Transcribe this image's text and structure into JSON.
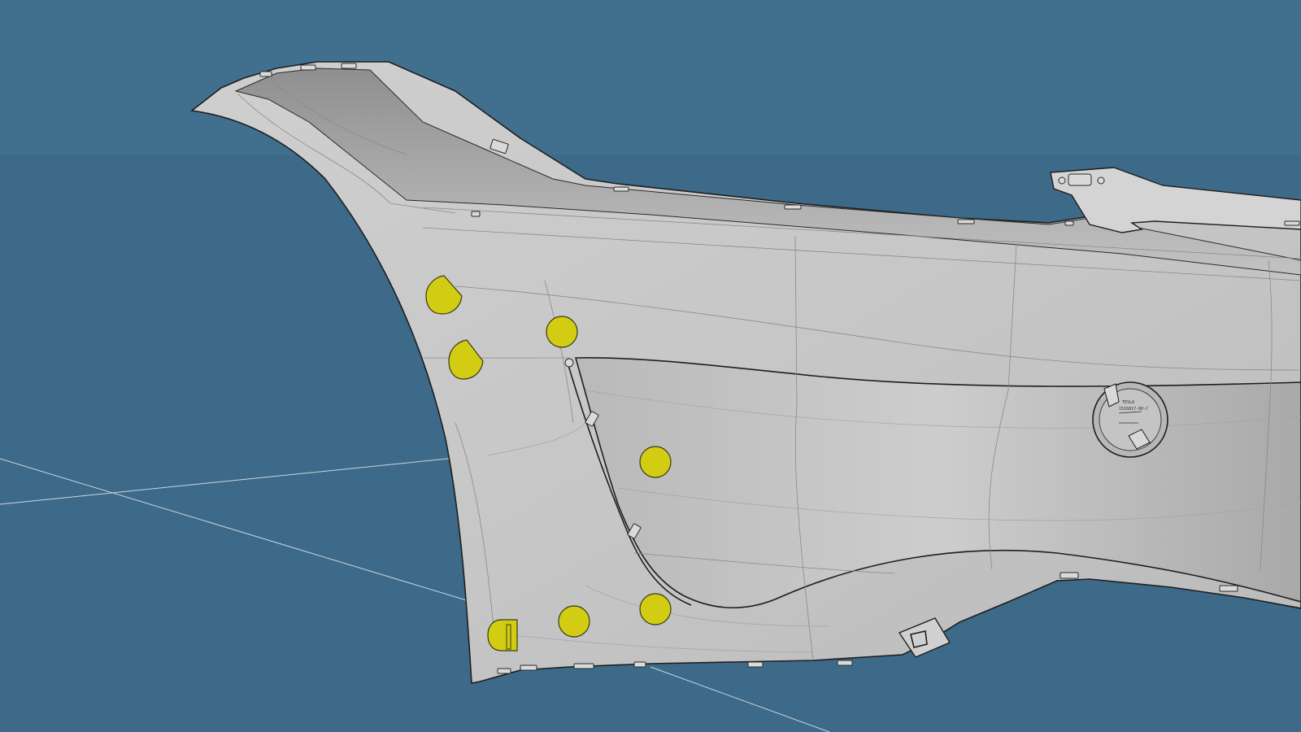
{
  "viewport": {
    "name": "3d-cad-viewport",
    "background_color": "#3d6a88",
    "horizon_band_color": "#41708f",
    "ground_axis_color": "#c9d6df",
    "part_surface_color": "#c4c4c4",
    "part_shadow_color": "#9e9e9e",
    "edge_color": "#1e1e1e",
    "marker_color": "#d2cd12"
  },
  "markers": [
    {
      "id": "marker-1",
      "shape": "teardrop"
    },
    {
      "id": "marker-2",
      "shape": "teardrop"
    },
    {
      "id": "marker-3",
      "shape": "circle"
    },
    {
      "id": "marker-4",
      "shape": "circle"
    },
    {
      "id": "marker-5",
      "shape": "circle"
    },
    {
      "id": "marker-6",
      "shape": "circle"
    },
    {
      "id": "marker-7",
      "shape": "square-with-slot"
    }
  ],
  "emblem": {
    "line1": "TESLA",
    "line2": "1516817-00-C"
  }
}
